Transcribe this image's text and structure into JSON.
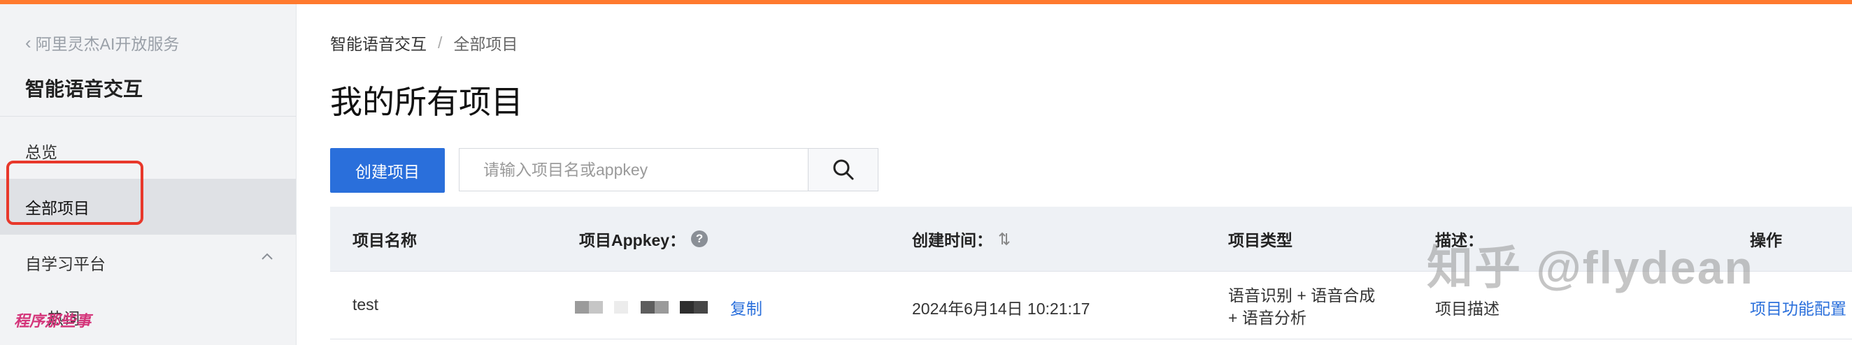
{
  "sidebar": {
    "back_label": "阿里灵杰AI开放服务",
    "product_title": "智能语音交互",
    "items": [
      {
        "label": "总览"
      },
      {
        "label": "全部项目"
      },
      {
        "label": "自学习平台"
      },
      {
        "label": "热词"
      }
    ],
    "watermark": "程序那些事"
  },
  "breadcrumb": {
    "root": "智能语音交互",
    "separator": "/",
    "current": "全部项目"
  },
  "page_title": "我的所有项目",
  "toolbar": {
    "create_label": "创建项目",
    "search_placeholder": "请输入项目名或appkey"
  },
  "table": {
    "columns": [
      "项目名称",
      "项目Appkey：",
      "创建时间：",
      "项目类型",
      "描述：",
      "操作"
    ],
    "rows": [
      {
        "name": "test",
        "appkey_action": "复制",
        "created": "2024年6月14日 10:21:17",
        "type_line1": "语音识别 + 语音合成",
        "type_line2": "+ 语音分析",
        "description": "项目描述",
        "action": "项目功能配置"
      }
    ]
  },
  "watermark": "知乎 @flydean",
  "colors": {
    "accent": "#2a6fdb",
    "highlight": "#e8382b",
    "topbar": "#ff7a2e"
  }
}
